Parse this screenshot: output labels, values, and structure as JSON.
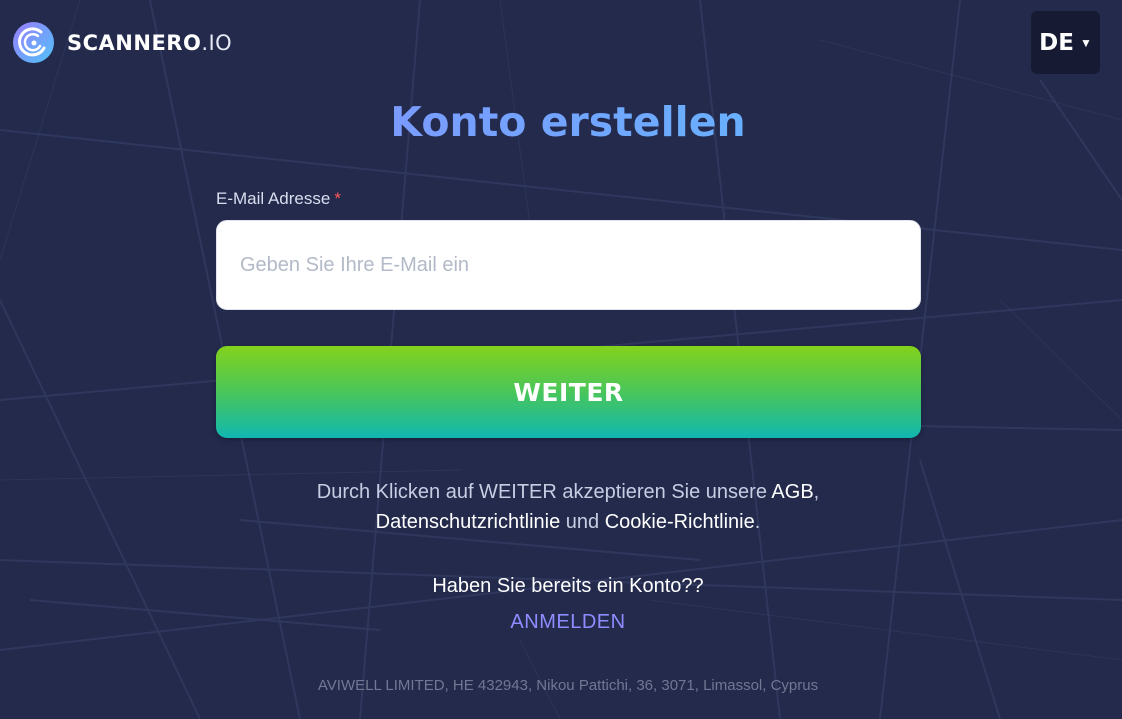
{
  "header": {
    "logo_text": "SCANNERO",
    "logo_tld": ".IO",
    "language_label": "DE"
  },
  "form": {
    "title": "Konto erstellen",
    "email_label": "E-Mail Adresse",
    "required_mark": "*",
    "email_placeholder": "Geben Sie Ihre E-Mail ein",
    "email_value": "",
    "submit_label": "WEITER"
  },
  "terms": {
    "prefix": "Durch Klicken auf WEITER akzeptieren Sie unsere ",
    "agb": "AGB",
    "comma": ",",
    "privacy": "Datenschutzrichtlinie",
    "and": " und ",
    "cookie": "Cookie-Richtlinie",
    "period": "."
  },
  "login": {
    "question": "Haben Sie bereits ein Konto??",
    "link_label": "ANMELDEN"
  },
  "footer": {
    "company": "AVIWELL LIMITED, HE 432943, Nikou Pattichi, 36, 3071, Limassol, Cyprus"
  },
  "colors": {
    "background": "#232a4c",
    "button_gradient_top": "#84d21b",
    "button_gradient_bottom": "#10b7b0",
    "login_link": "#8e8cff",
    "required": "#ff5a5a"
  },
  "icons": {
    "logo": "scanner-radar-icon",
    "language_caret": "caret-down-icon"
  }
}
